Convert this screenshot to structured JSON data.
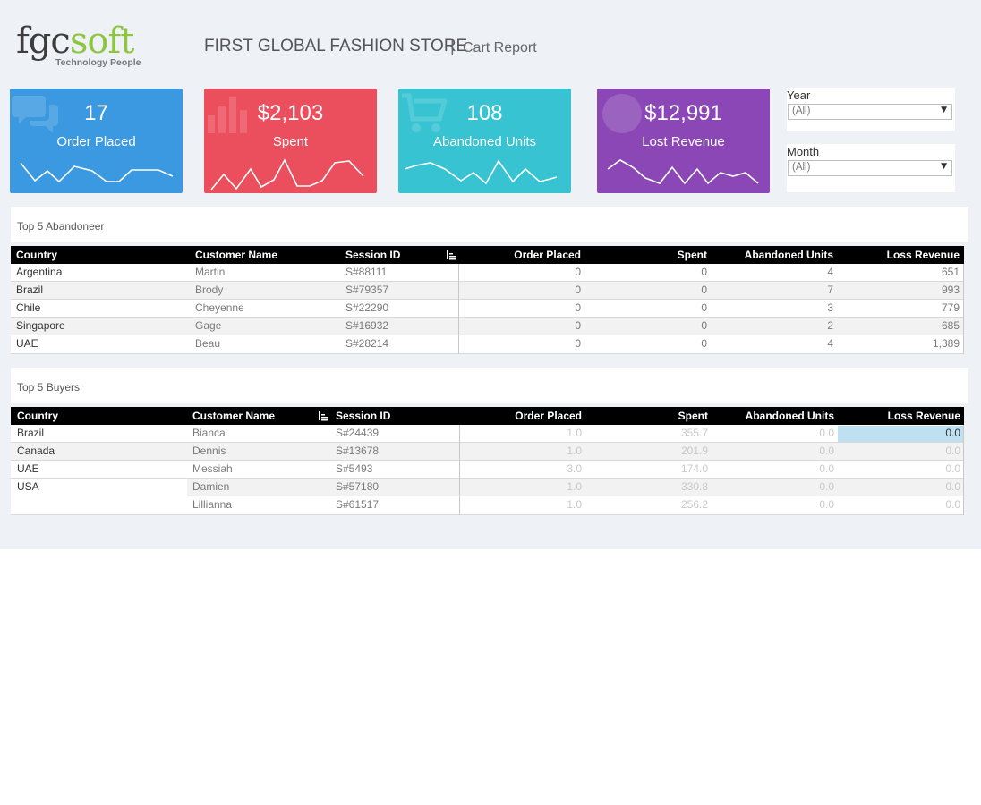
{
  "header": {
    "logo_main_1": "fgc",
    "logo_main_2": "soft",
    "logo_tagline": "Technology People",
    "store_title": "FIRST GLOBAL FASHION STORE",
    "separator": "|",
    "report_title": "Cart Report"
  },
  "kpis": [
    {
      "value": "17",
      "label": "Order Placed",
      "color": "#3a99e0",
      "icon": "chat-bubble-icon"
    },
    {
      "value": "$2,103",
      "label": "Spent",
      "color": "#eb4f5d",
      "icon": "bar-chart-icon"
    },
    {
      "value": "108",
      "label": "Abandoned Units",
      "color": "#37c3d2",
      "icon": "shopping-cart-icon"
    },
    {
      "value": "$12,991",
      "label": "Lost Revenue",
      "color": "#8a47b5",
      "icon": "globe-icon"
    }
  ],
  "filters": {
    "year": {
      "label": "Year",
      "value": "(All)"
    },
    "month": {
      "label": "Month",
      "value": "(All)"
    }
  },
  "abandoneer": {
    "title": "Top 5 Abandoneer",
    "columns": [
      "Country",
      "Customer Name",
      "Session ID",
      "Order Placed",
      "Spent",
      "Abandoned Units",
      "Loss Revenue"
    ],
    "rows": [
      {
        "country": "Argentina",
        "customer": "Martin",
        "session": "S#88111",
        "orders": "0",
        "spent": "0",
        "units": "4",
        "loss": "651"
      },
      {
        "country": "Brazil",
        "customer": "Brody",
        "session": "S#79357",
        "orders": "0",
        "spent": "0",
        "units": "7",
        "loss": "993"
      },
      {
        "country": "Chile",
        "customer": "Cheyenne",
        "session": "S#22290",
        "orders": "0",
        "spent": "0",
        "units": "3",
        "loss": "779"
      },
      {
        "country": "Singapore",
        "customer": "Gage",
        "session": "S#16932",
        "orders": "0",
        "spent": "0",
        "units": "2",
        "loss": "685"
      },
      {
        "country": "UAE",
        "customer": "Beau",
        "session": "S#28214",
        "orders": "0",
        "spent": "0",
        "units": "4",
        "loss": "1,389"
      }
    ]
  },
  "buyers": {
    "title": "Top 5 Buyers",
    "columns": [
      "Country",
      "Customer Name",
      "Session ID",
      "Order Placed",
      "Spent",
      "Abandoned Units",
      "Loss Revenue"
    ],
    "rows": [
      {
        "country": "Brazil",
        "customer": "Bianca",
        "session": "S#24439",
        "orders": "1.0",
        "spent": "355.7",
        "units": "0.0",
        "loss": "0.0"
      },
      {
        "country": "Canada",
        "customer": "Dennis",
        "session": "S#13678",
        "orders": "1.0",
        "spent": "201.9",
        "units": "0.0",
        "loss": "0.0"
      },
      {
        "country": "UAE",
        "customer": "Messiah",
        "session": "S#5493",
        "orders": "3.0",
        "spent": "174.0",
        "units": "0.0",
        "loss": "0.0"
      },
      {
        "country": "USA",
        "customer": "Damien",
        "session": "S#57180",
        "orders": "1.0",
        "spent": "330.8",
        "units": "0.0",
        "loss": "0.0"
      },
      {
        "country": "",
        "customer": "Lillianna",
        "session": "S#61517",
        "orders": "1.0",
        "spent": "256.2",
        "units": "0.0",
        "loss": "0.0"
      }
    ]
  }
}
